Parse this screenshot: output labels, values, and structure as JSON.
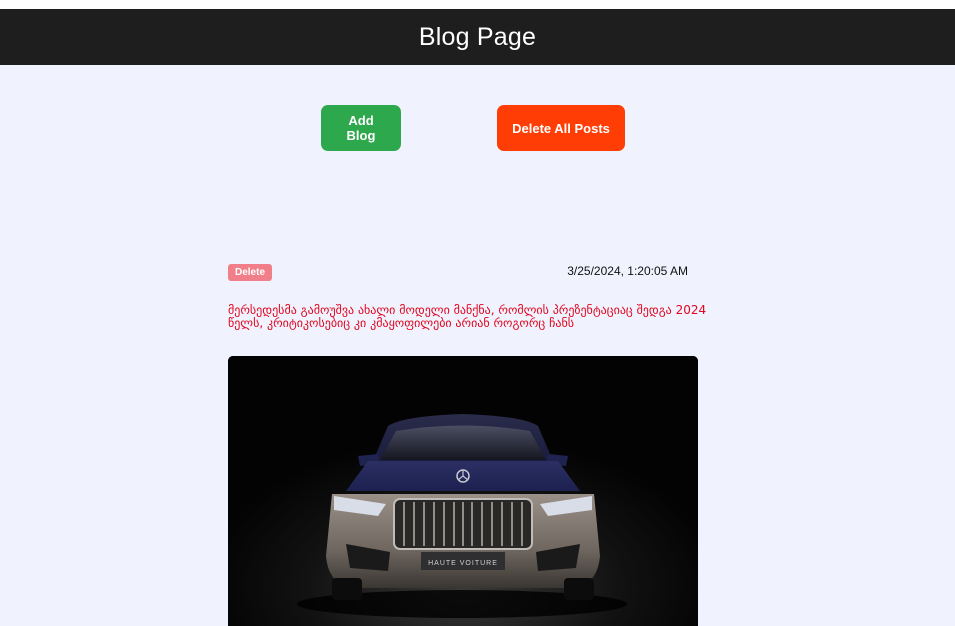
{
  "header": {
    "title": "Blog Page"
  },
  "toolbar": {
    "add_label": "Add Blog",
    "delete_all_label": "Delete All Posts"
  },
  "posts": [
    {
      "delete_label": "Delete",
      "timestamp": "3/25/2024, 1:20:05 AM",
      "text": "მერსედესმა გამოუშვა ახალი მოდელი მანქნა, რომლის პრეზენტაციაც შედგა 2024 წელს, კრიტიკოსებიც კი კმაყოფილები არიან როგორც ჩანს",
      "image": {
        "plate_text": "HAUTE VOITURE",
        "subject": "car-photo"
      }
    }
  ],
  "colors": {
    "header_bg": "#1e1e1e",
    "page_bg": "#f0f2fe",
    "add_button": "#2ea84d",
    "delete_all_button": "#ff3d04",
    "delete_button": "#f07f8a",
    "post_text": "#e0061d"
  }
}
